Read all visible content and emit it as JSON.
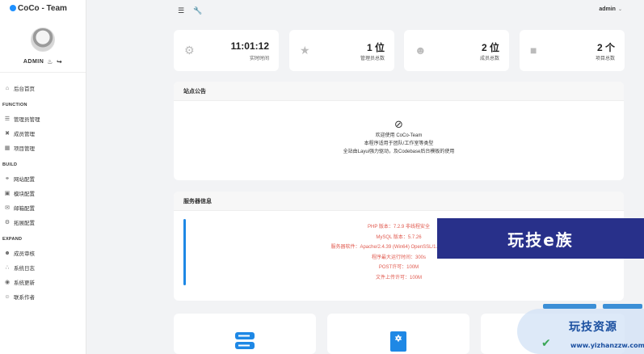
{
  "brand": {
    "title": "CoCo - Team"
  },
  "profile": {
    "name": "ADMIN"
  },
  "menu": {
    "home": "后台首页",
    "sections": [
      {
        "title": "FUNCTION",
        "items": [
          {
            "label": "管理员管理",
            "icon": "list-icon"
          },
          {
            "label": "成员管理",
            "icon": "tools-icon"
          },
          {
            "label": "项目管理",
            "icon": "grid-icon"
          }
        ]
      },
      {
        "title": "BUILD",
        "items": [
          {
            "label": "网站配置",
            "icon": "link-icon"
          },
          {
            "label": "模块配置",
            "icon": "module-icon"
          },
          {
            "label": "邮箱配置",
            "icon": "mail-icon"
          },
          {
            "label": "拓展配置",
            "icon": "extension-icon"
          }
        ]
      },
      {
        "title": "EXPAND",
        "items": [
          {
            "label": "成员审核",
            "icon": "user-add-icon"
          },
          {
            "label": "系统日志",
            "icon": "chart-icon"
          },
          {
            "label": "系统更新",
            "icon": "globe-icon"
          },
          {
            "label": "联系作者",
            "icon": "contact-icon"
          }
        ]
      }
    ]
  },
  "header": {
    "user": "admin"
  },
  "stats": [
    {
      "value": "11:01:12",
      "label": "实时时间",
      "icon": "network-icon"
    },
    {
      "value": "1 位",
      "label": "管理员总数",
      "icon": "team-icon"
    },
    {
      "value": "2 位",
      "label": "成员总数",
      "icon": "users-icon"
    },
    {
      "value": "2 个",
      "label": "项目总数",
      "icon": "bag-icon"
    }
  ],
  "notice": {
    "title": "站点公告",
    "lines": [
      "欢迎使用 CoCo-Team",
      "本程序适用于团队/工作室等类型",
      "全站由Layui强力驱动，及Codebase后台模板的使用"
    ]
  },
  "server": {
    "title": "服务器信息",
    "lines": [
      "PHP 版本：7.2.9 非线程安全",
      "MySQL 版本：5.7.26",
      "服务器软件：Apache/2.4.39 (Win64) OpenSSL/1.1.1b mod_fcg",
      "程序最大运行时间：300s",
      "POST许可：100M",
      "文件上传许可：100M"
    ]
  },
  "watermark": {
    "banner": "玩技e族",
    "name": "玩技资源",
    "url": "www.yizhanzzw.com"
  },
  "colors": {
    "accent": "#1e88e5",
    "danger_text": "#e05a4f",
    "watermark_blue": "#28308a"
  }
}
